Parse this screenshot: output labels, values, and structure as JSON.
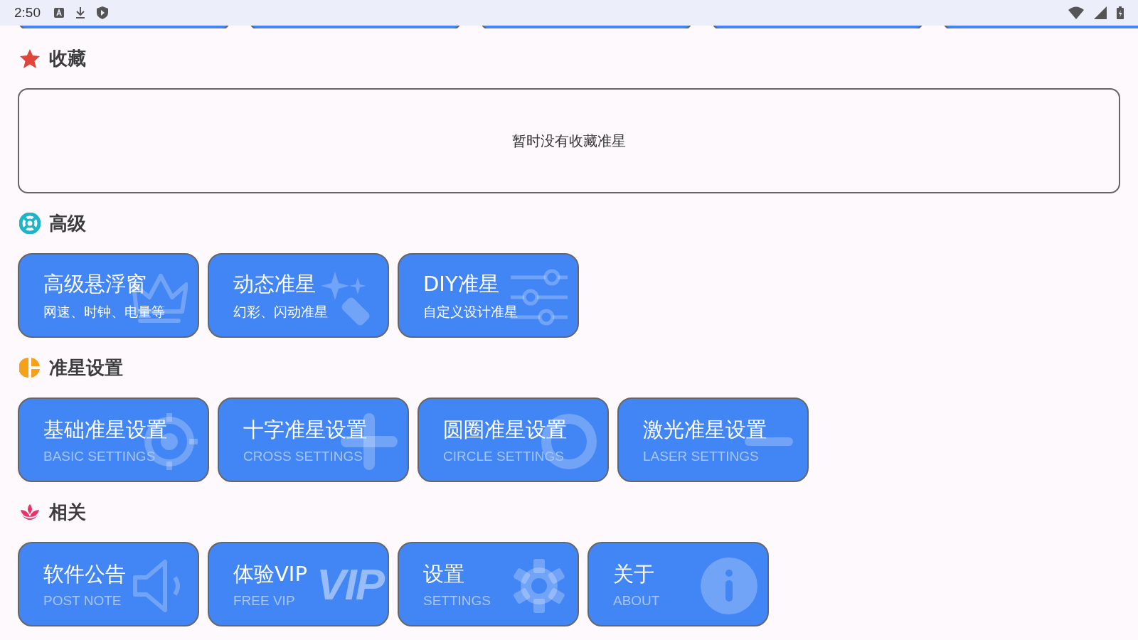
{
  "status_bar": {
    "time": "2:50"
  },
  "sections": [
    {
      "kind": "favorites",
      "title": "收藏",
      "empty_text": "暂时没有收藏准星"
    },
    {
      "kind": "feature",
      "title": "高级",
      "cards": [
        {
          "title": "高级悬浮窗",
          "subtitle": "网速、时钟、电量等"
        },
        {
          "title": "动态准星",
          "subtitle": "幻彩、闪动准星"
        },
        {
          "title": "DIY准星",
          "subtitle": "自定义设计准星"
        }
      ]
    },
    {
      "kind": "setting-wide",
      "title": "准星设置",
      "cards": [
        {
          "title": "基础准星设置",
          "subtitle": "BASIC SETTINGS"
        },
        {
          "title": "十字准星设置",
          "subtitle": "CROSS SETTINGS"
        },
        {
          "title": "圆圈准星设置",
          "subtitle": "CIRCLE SETTINGS"
        },
        {
          "title": "激光准星设置",
          "subtitle": "LASER SETTINGS"
        }
      ]
    },
    {
      "kind": "setting",
      "title": "相关",
      "cards": [
        {
          "title": "软件公告",
          "subtitle": "POST NOTE"
        },
        {
          "title": "体验VIP",
          "subtitle": "FREE VIP",
          "badge": "VIP"
        },
        {
          "title": "设置",
          "subtitle": "SETTINGS"
        },
        {
          "title": "关于",
          "subtitle": "ABOUT"
        }
      ]
    }
  ]
}
